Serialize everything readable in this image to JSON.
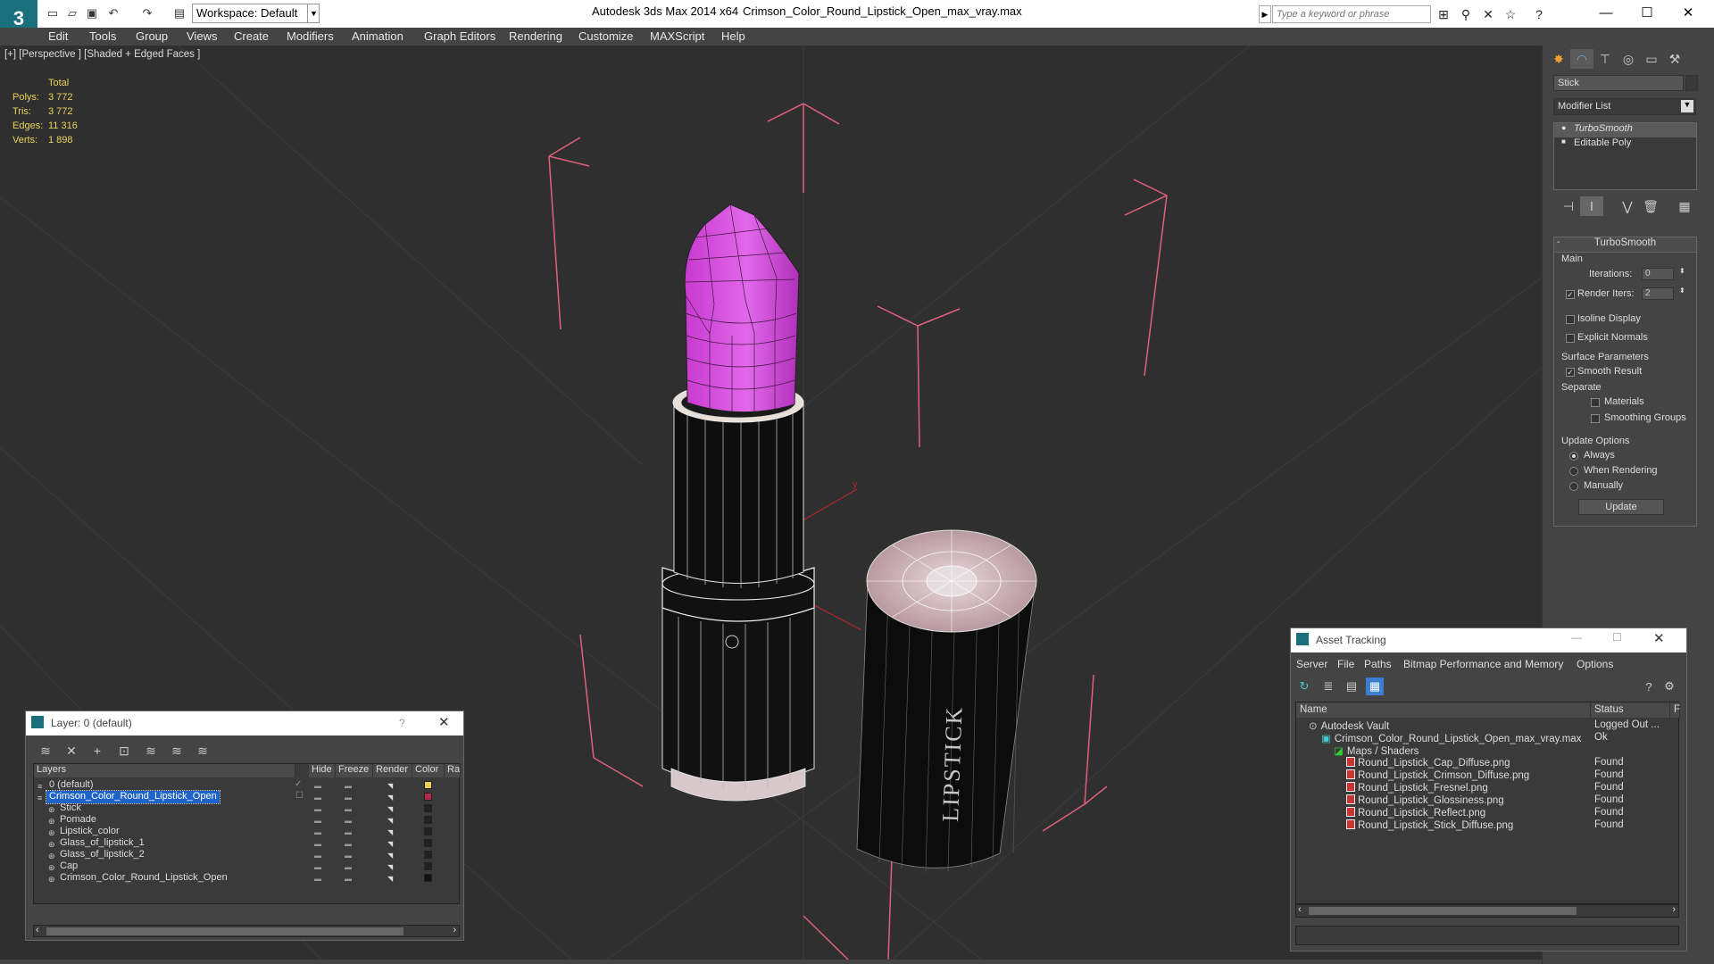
{
  "titlebar": {
    "workspace": "Workspace: Default",
    "app_title": "Autodesk 3ds Max  2014 x64",
    "doc_title": "Crimson_Color_Round_Lipstick_Open_max_vray.max",
    "search_placeholder": "Type a keyword or phrase"
  },
  "menu": [
    "Edit",
    "Tools",
    "Group",
    "Views",
    "Create",
    "Modifiers",
    "Animation",
    "Graph Editors",
    "Rendering",
    "Customize",
    "MAXScript",
    "Help"
  ],
  "viewport": {
    "label": "[+] [Perspective ] [Shaded + Edged Faces ]",
    "stats_header": "Total",
    "stats": [
      {
        "k": "Polys:",
        "v": "3 772"
      },
      {
        "k": "Tris:",
        "v": "3 772"
      },
      {
        "k": "Edges:",
        "v": "11 316"
      },
      {
        "k": "Verts:",
        "v": "1 898"
      }
    ],
    "cap_text": "LIPSTICK",
    "axis_y": "y"
  },
  "command_panel": {
    "object_name": "Stick",
    "modifier_list": "Modifier List",
    "stack": [
      "TurboSmooth",
      "Editable Poly"
    ],
    "rollout_title": "TurboSmooth",
    "main_group": "Main",
    "iterations_label": "Iterations:",
    "iterations_value": "0",
    "render_iters_label": "Render Iters:",
    "render_iters_value": "2",
    "isoline": "Isoline Display",
    "explicit_normals": "Explicit Normals",
    "surface_group": "Surface Parameters",
    "smooth_result": "Smooth Result",
    "separate": "Separate",
    "materials": "Materials",
    "smoothing_groups": "Smoothing Groups",
    "update_group": "Update Options",
    "always": "Always",
    "when_rendering": "When Rendering",
    "manually": "Manually",
    "update_button": "Update"
  },
  "layer_dialog": {
    "title": "Layer: 0 (default)",
    "help": "?",
    "columns": [
      "Layers",
      "Hide",
      "Freeze",
      "Render",
      "Color",
      "Ra"
    ],
    "rows": [
      {
        "name": "0 (default)",
        "color": "#e8d35a",
        "indent": 1
      },
      {
        "name": "Crimson_Color_Round_Lipstick_Open",
        "color": "#b0284a",
        "indent": 1,
        "selected": true
      },
      {
        "name": "Stick",
        "color": "#222222",
        "indent": 2
      },
      {
        "name": "Pomade",
        "color": "#222222",
        "indent": 2
      },
      {
        "name": "Lipstick_color",
        "color": "#222222",
        "indent": 2
      },
      {
        "name": "Glass_of_lipstick_1",
        "color": "#222222",
        "indent": 2
      },
      {
        "name": "Glass_of_lipstick_2",
        "color": "#222222",
        "indent": 2
      },
      {
        "name": "Cap",
        "color": "#222222",
        "indent": 2
      },
      {
        "name": "Crimson_Color_Round_Lipstick_Open",
        "color": "#111111",
        "indent": 2
      }
    ]
  },
  "asset_dialog": {
    "title": "Asset Tracking",
    "menu": [
      "Server",
      "File",
      "Paths",
      "Bitmap Performance and Memory",
      "Options"
    ],
    "columns": [
      "Name",
      "Status",
      "F"
    ],
    "rows": [
      {
        "name": "Autodesk Vault",
        "status": "Logged Out ...",
        "indent": 1,
        "icon": "vault"
      },
      {
        "name": "Crimson_Color_Round_Lipstick_Open_max_vray.max",
        "status": "Ok",
        "indent": 2,
        "icon": "max"
      },
      {
        "name": "Maps / Shaders",
        "status": "",
        "indent": 3,
        "icon": "maps"
      },
      {
        "name": "Round_Lipstick_Cap_Diffuse.png",
        "status": "Found",
        "indent": 4,
        "icon": "png"
      },
      {
        "name": "Round_Lipstick_Crimson_Diffuse.png",
        "status": "Found",
        "indent": 4,
        "icon": "png"
      },
      {
        "name": "Round_Lipstick_Fresnel.png",
        "status": "Found",
        "indent": 4,
        "icon": "png"
      },
      {
        "name": "Round_Lipstick_Glossiness.png",
        "status": "Found",
        "indent": 4,
        "icon": "png"
      },
      {
        "name": "Round_Lipstick_Reflect.png",
        "status": "Found",
        "indent": 4,
        "icon": "png"
      },
      {
        "name": "Round_Lipstick_Stick_Diffuse.png",
        "status": "Found",
        "indent": 4,
        "icon": "png"
      }
    ]
  },
  "colors": {
    "accent": "#1e63c8",
    "stats": "#e8d35a",
    "bracket": "#e0607a",
    "pomade": "#c040c8"
  }
}
